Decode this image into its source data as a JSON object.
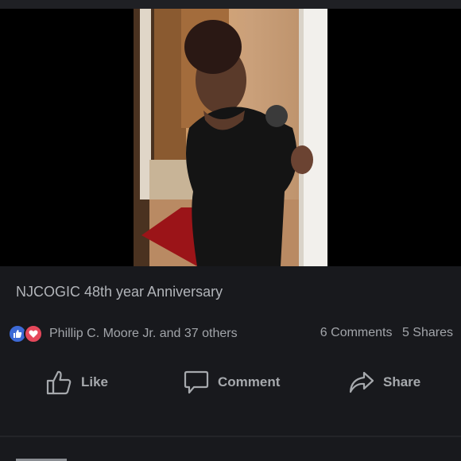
{
  "post": {
    "text": "NJCOGIC 48th year Anniversary"
  },
  "reactions": {
    "text": "Phillip C. Moore Jr. and 37 others",
    "icons": [
      "like-icon",
      "love-icon"
    ],
    "like_color": "#3d6ad6",
    "love_color": "#e5485b"
  },
  "counts": {
    "comments": "6 Comments",
    "shares": "5 Shares"
  },
  "actions": {
    "like": "Like",
    "comment": "Comment",
    "share": "Share"
  },
  "colors": {
    "background": "#18191d",
    "text": "#a9acb1"
  }
}
